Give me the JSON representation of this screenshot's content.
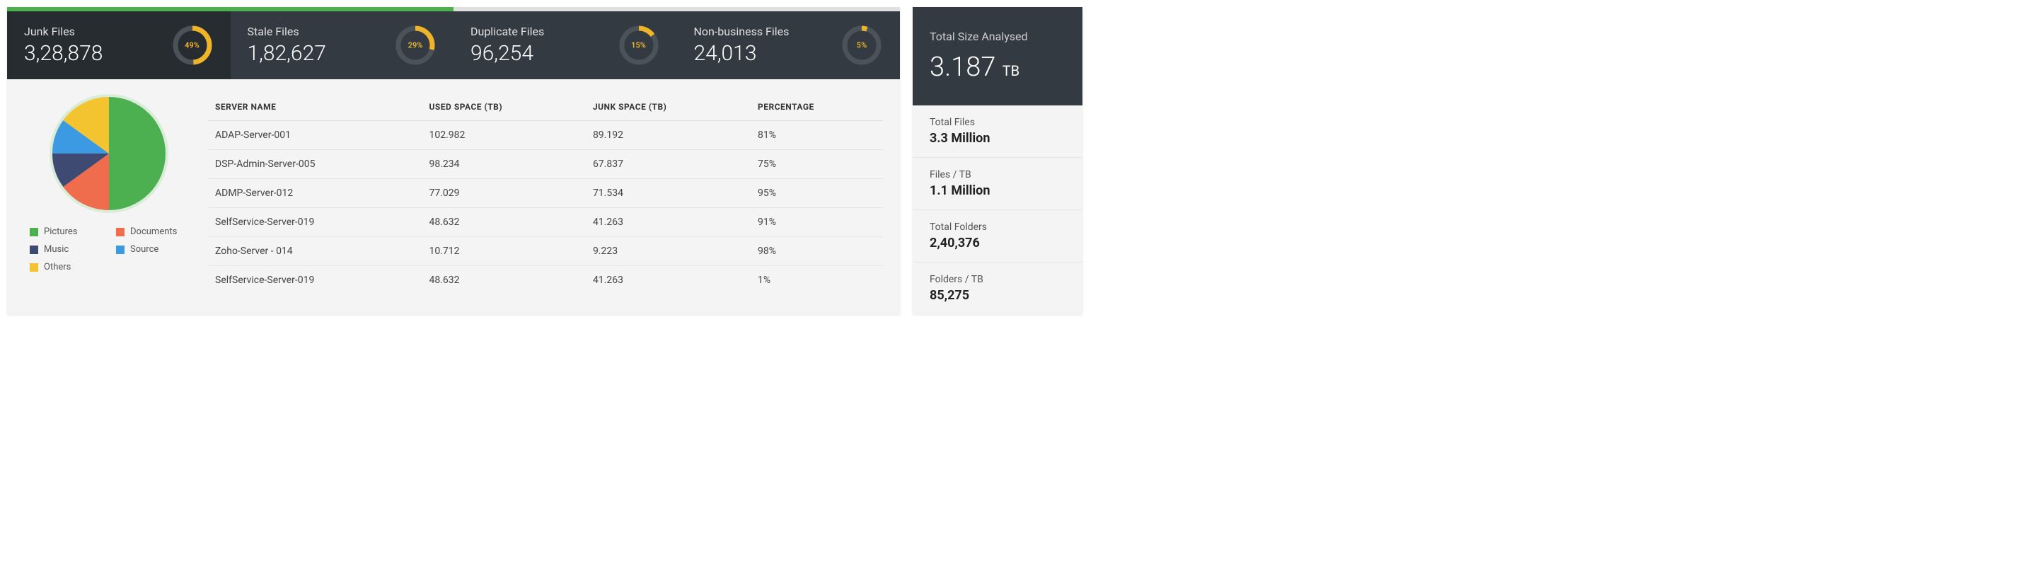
{
  "stats": [
    {
      "label": "Junk Files",
      "value": "3,28,878",
      "percent": 49
    },
    {
      "label": "Stale Files",
      "value": "1,82,627",
      "percent": 29
    },
    {
      "label": "Duplicate Files",
      "value": "96,254",
      "percent": 15
    },
    {
      "label": "Non-business Files",
      "value": "24,013",
      "percent": 5
    }
  ],
  "chart_data": {
    "type": "pie",
    "title": "",
    "series": [
      {
        "name": "Pictures",
        "value": 50,
        "color": "#4CAF50"
      },
      {
        "name": "Documents",
        "value": 15,
        "color": "#EF6C4D"
      },
      {
        "name": "Music",
        "value": 10,
        "color": "#3F4A72"
      },
      {
        "name": "Source",
        "value": 10,
        "color": "#3B9AE1"
      },
      {
        "name": "Others",
        "value": 15,
        "color": "#F4C430"
      }
    ]
  },
  "table": {
    "headers": [
      "SERVER NAME",
      "USED SPACE (TB)",
      "JUNK SPACE (TB)",
      "PERCENTAGE"
    ],
    "rows": [
      [
        "ADAP-Server-001",
        "102.982",
        "89.192",
        "81%"
      ],
      [
        "DSP-Admin-Server-005",
        "98.234",
        "67.837",
        "75%"
      ],
      [
        "ADMP-Server-012",
        "77.029",
        "71.534",
        "95%"
      ],
      [
        "SelfService-Server-019",
        "48.632",
        "41.263",
        "91%"
      ],
      [
        "Zoho-Server - 014",
        "10.712",
        "9.223",
        "98%"
      ],
      [
        "SelfService-Server-019",
        "48.632",
        "41.263",
        "1%"
      ]
    ]
  },
  "total_size": {
    "label": "Total Size Analysed",
    "value": "3.187",
    "unit": "TB"
  },
  "info": [
    {
      "label": "Total Files",
      "value": "3.3 Million"
    },
    {
      "label": "Files / TB",
      "value": "1.1 Million"
    },
    {
      "label": "Total Folders",
      "value": "2,40,376"
    },
    {
      "label": "Folders / TB",
      "value": "85,275"
    }
  ],
  "colors": {
    "donut_track": "#4a525a",
    "donut_fill": "#f0b429"
  }
}
